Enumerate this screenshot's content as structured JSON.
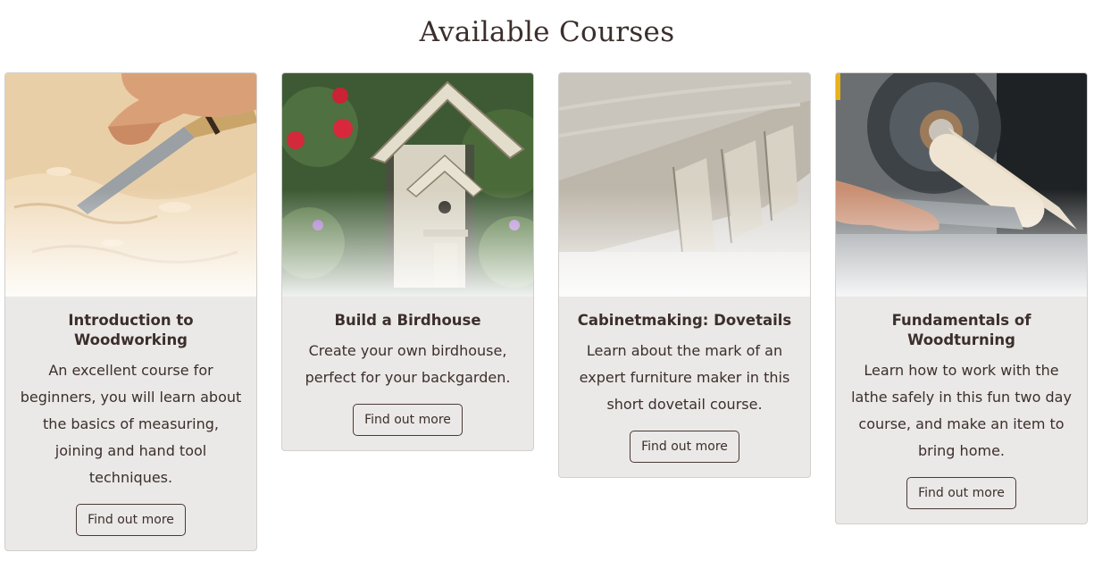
{
  "page": {
    "title": "Available Courses"
  },
  "courses": [
    {
      "title": "Introduction to Woodworking",
      "description": "An excellent course for beginners, you will learn about the basics of measuring, joining and hand tool techniques.",
      "button_label": "Find out more",
      "image_icon": "chisel-carving-photo"
    },
    {
      "title": "Build a Birdhouse",
      "description": "Create your own birdhouse, perfect for your backgarden.",
      "button_label": "Find out more",
      "image_icon": "birdhouse-photo"
    },
    {
      "title": "Cabinetmaking: Dovetails",
      "description": "Learn about the mark of an expert furniture maker in this short dovetail course.",
      "button_label": "Find out more",
      "image_icon": "dovetail-joint-photo"
    },
    {
      "title": "Fundamentals of Woodturning",
      "description": "Learn how to work with the lathe safely in this fun two day course, and make an item to bring home.",
      "button_label": "Find out more",
      "image_icon": "lathe-photo"
    }
  ],
  "colors": {
    "text": "#3b2f2c",
    "card_bg": "#ebe9e7",
    "card_border": "#d2cfcc",
    "button_border": "#4a3a35"
  }
}
